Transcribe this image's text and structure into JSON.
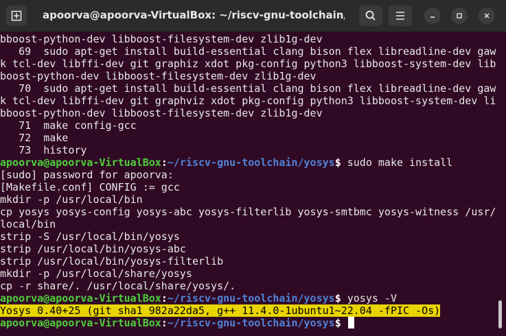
{
  "window": {
    "title": "apoorva@apoorva-VirtualBox: ~/riscv-gnu-toolchain/yosys",
    "icons": [
      "new-tab-icon",
      "search-icon",
      "hamburger-menu-icon",
      "minimize-icon",
      "maximize-icon",
      "close-icon"
    ]
  },
  "terminal": {
    "lines": [
      {
        "kind": "text",
        "text": "bboost-python-dev libboost-filesystem-dev zlib1g-dev"
      },
      {
        "kind": "text",
        "text": "   69  sudo apt-get install build-essential clang bison flex libreadline-dev gaw"
      },
      {
        "kind": "text",
        "text": "k tcl-dev libffi-dev git graphiz xdot pkg-config python3 libboost-system-dev lib"
      },
      {
        "kind": "text",
        "text": "boost-python-dev libboost-filesystem-dev zlib1g-dev"
      },
      {
        "kind": "text",
        "text": "   70  sudo apt-get install build-essential clang bison flex libreadline-dev gaw"
      },
      {
        "kind": "text",
        "text": "k tcl-dev libffi-dev git graphviz xdot pkg-config python3 libboost-system-dev li"
      },
      {
        "kind": "text",
        "text": "bboost-python-dev libboost-filesystem-dev zlib1g-dev"
      },
      {
        "kind": "text",
        "text": "   71  make config-gcc"
      },
      {
        "kind": "text",
        "text": "   72  make"
      },
      {
        "kind": "text",
        "text": "   73  history"
      },
      {
        "kind": "prompt",
        "user": "apoorva@apoorva-VirtualBox",
        "colon": ":",
        "path": "~/riscv-gnu-toolchain/yosys",
        "dollar": "$",
        "command": " sudo make install"
      },
      {
        "kind": "text",
        "text": "[sudo] password for apoorva:"
      },
      {
        "kind": "text",
        "text": "[Makefile.conf] CONFIG := gcc"
      },
      {
        "kind": "text",
        "text": "mkdir -p /usr/local/bin"
      },
      {
        "kind": "text",
        "text": "cp yosys yosys-config yosys-abc yosys-filterlib yosys-smtbmc yosys-witness /usr/"
      },
      {
        "kind": "text",
        "text": "local/bin"
      },
      {
        "kind": "text",
        "text": "strip -S /usr/local/bin/yosys"
      },
      {
        "kind": "text",
        "text": "strip /usr/local/bin/yosys-abc"
      },
      {
        "kind": "text",
        "text": "strip /usr/local/bin/yosys-filterlib"
      },
      {
        "kind": "text",
        "text": "mkdir -p /usr/local/share/yosys"
      },
      {
        "kind": "text",
        "text": "cp -r share/. /usr/local/share/yosys/."
      },
      {
        "kind": "prompt",
        "user": "apoorva@apoorva-VirtualBox",
        "colon": ":",
        "path": "~/riscv-gnu-toolchain/yosys",
        "dollar": "$",
        "command": " yosys -V"
      },
      {
        "kind": "highlight",
        "text": "Yosys 0.40+25 (git sha1 982a22da5, g++ 11.4.0-1ubuntu1~22.04 -fPIC -Os)"
      },
      {
        "kind": "prompt",
        "user": "apoorva@apoorva-VirtualBox",
        "colon": ":",
        "path": "~/riscv-gnu-toolchain/yosys",
        "dollar": "$",
        "command": " ",
        "cursor": true
      }
    ]
  }
}
